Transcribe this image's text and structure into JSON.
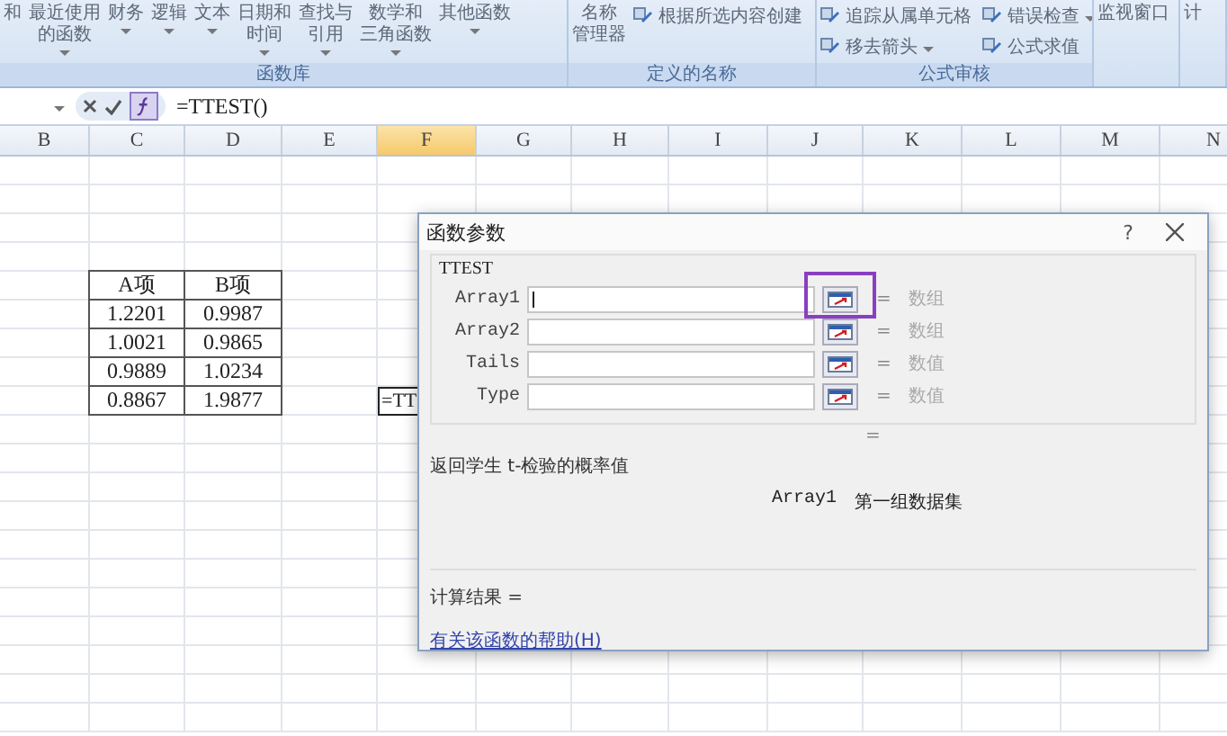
{
  "ribbon": {
    "groups": [
      {
        "label": "函数库",
        "items": [
          {
            "kind": "large",
            "lines": [
              "和"
            ],
            "dropdown": false
          },
          {
            "kind": "large",
            "lines": [
              "最近使用",
              "的函数"
            ],
            "dropdown": true
          },
          {
            "kind": "large",
            "lines": [
              "财务"
            ],
            "dropdown": true
          },
          {
            "kind": "large",
            "lines": [
              "逻辑"
            ],
            "dropdown": true
          },
          {
            "kind": "large",
            "lines": [
              "文本"
            ],
            "dropdown": true
          },
          {
            "kind": "large",
            "lines": [
              "日期和",
              "时间"
            ],
            "dropdown": true
          },
          {
            "kind": "large",
            "lines": [
              "查找与",
              "引用"
            ],
            "dropdown": true
          },
          {
            "kind": "large",
            "lines": [
              "数学和",
              "三角函数"
            ],
            "dropdown": true
          },
          {
            "kind": "large",
            "lines": [
              "其他函数"
            ],
            "dropdown": true
          }
        ]
      },
      {
        "label": "定义的名称",
        "items": [
          {
            "kind": "large",
            "lines": [
              "名称",
              "管理器"
            ],
            "dropdown": false
          },
          {
            "kind": "small",
            "lines": [
              "根据所选内容创建"
            ],
            "dropdown": false
          }
        ]
      },
      {
        "label": "公式审核",
        "items": [
          {
            "kind": "small",
            "lines": [
              "追踪从属单元格"
            ],
            "dropdown": false
          },
          {
            "kind": "small",
            "lines": [
              "移去箭头"
            ],
            "dropdown": true
          },
          {
            "kind": "small",
            "lines": [
              "错误检查"
            ],
            "dropdown": true
          },
          {
            "kind": "small",
            "lines": [
              "公式求值"
            ],
            "dropdown": false
          }
        ]
      },
      {
        "items": [
          {
            "kind": "large",
            "lines": [
              "监视窗口"
            ],
            "dropdown": false
          }
        ]
      },
      {
        "items": [
          {
            "kind": "large",
            "lines": [
              "计"
            ],
            "dropdown": false
          }
        ]
      }
    ]
  },
  "formula_bar": {
    "formula": "=TTEST()"
  },
  "columns": [
    {
      "label": "B",
      "selected": false
    },
    {
      "label": "C",
      "selected": false
    },
    {
      "label": "D",
      "selected": false
    },
    {
      "label": "E",
      "selected": false
    },
    {
      "label": "F",
      "selected": true
    },
    {
      "label": "G",
      "selected": false
    },
    {
      "label": "H",
      "selected": false
    },
    {
      "label": "I",
      "selected": false
    },
    {
      "label": "J",
      "selected": false
    },
    {
      "label": "K",
      "selected": false
    },
    {
      "label": "L",
      "selected": false
    },
    {
      "label": "M",
      "selected": false
    },
    {
      "label": "N",
      "selected": false
    }
  ],
  "table": {
    "header": [
      "A项",
      "B项"
    ],
    "rows": [
      [
        "1.2201",
        "0.9987"
      ],
      [
        "1.0021",
        "0.9865"
      ],
      [
        "0.9889",
        "1.0234"
      ],
      [
        "0.8867",
        "1.9877"
      ]
    ]
  },
  "active_cell": {
    "text": "=TT"
  },
  "dialog": {
    "title": "函数参数",
    "help_button": "?",
    "function_name": "TTEST",
    "arguments": [
      {
        "name": "Array1",
        "hint": "数组",
        "focused": true,
        "highlighted": true
      },
      {
        "name": "Array2",
        "hint": "数组",
        "focused": false,
        "highlighted": false
      },
      {
        "name": "Tails",
        "hint": "数值",
        "focused": false,
        "highlighted": false
      },
      {
        "name": "Type",
        "hint": "数值",
        "focused": false,
        "highlighted": false
      }
    ],
    "arg_equals": "=",
    "result_equals": "=",
    "description": "返回学生 t-检验的概率值",
    "argument_help": {
      "name": "Array1",
      "text": "第一组数据集"
    },
    "result_label": "计算结果 =",
    "help_link": "有关该函数的帮助(H)"
  }
}
